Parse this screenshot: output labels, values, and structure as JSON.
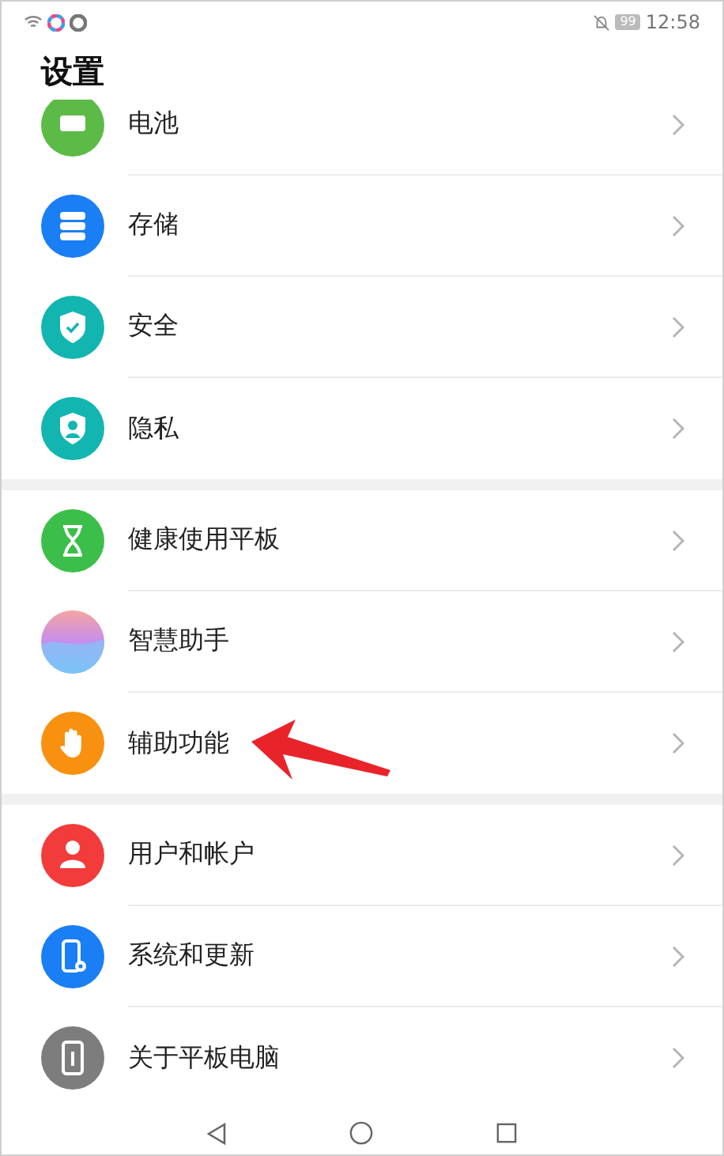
{
  "status_bar": {
    "battery": "99",
    "time": "12:58"
  },
  "title": "设置",
  "groups": [
    {
      "items": [
        {
          "label": "电池"
        },
        {
          "label": "存储"
        },
        {
          "label": "安全"
        },
        {
          "label": "隐私"
        }
      ]
    },
    {
      "items": [
        {
          "label": "健康使用平板"
        },
        {
          "label": "智慧助手"
        },
        {
          "label": "辅助功能"
        }
      ]
    },
    {
      "items": [
        {
          "label": "用户和帐户"
        },
        {
          "label": "系统和更新"
        },
        {
          "label": "关于平板电脑"
        }
      ]
    }
  ]
}
